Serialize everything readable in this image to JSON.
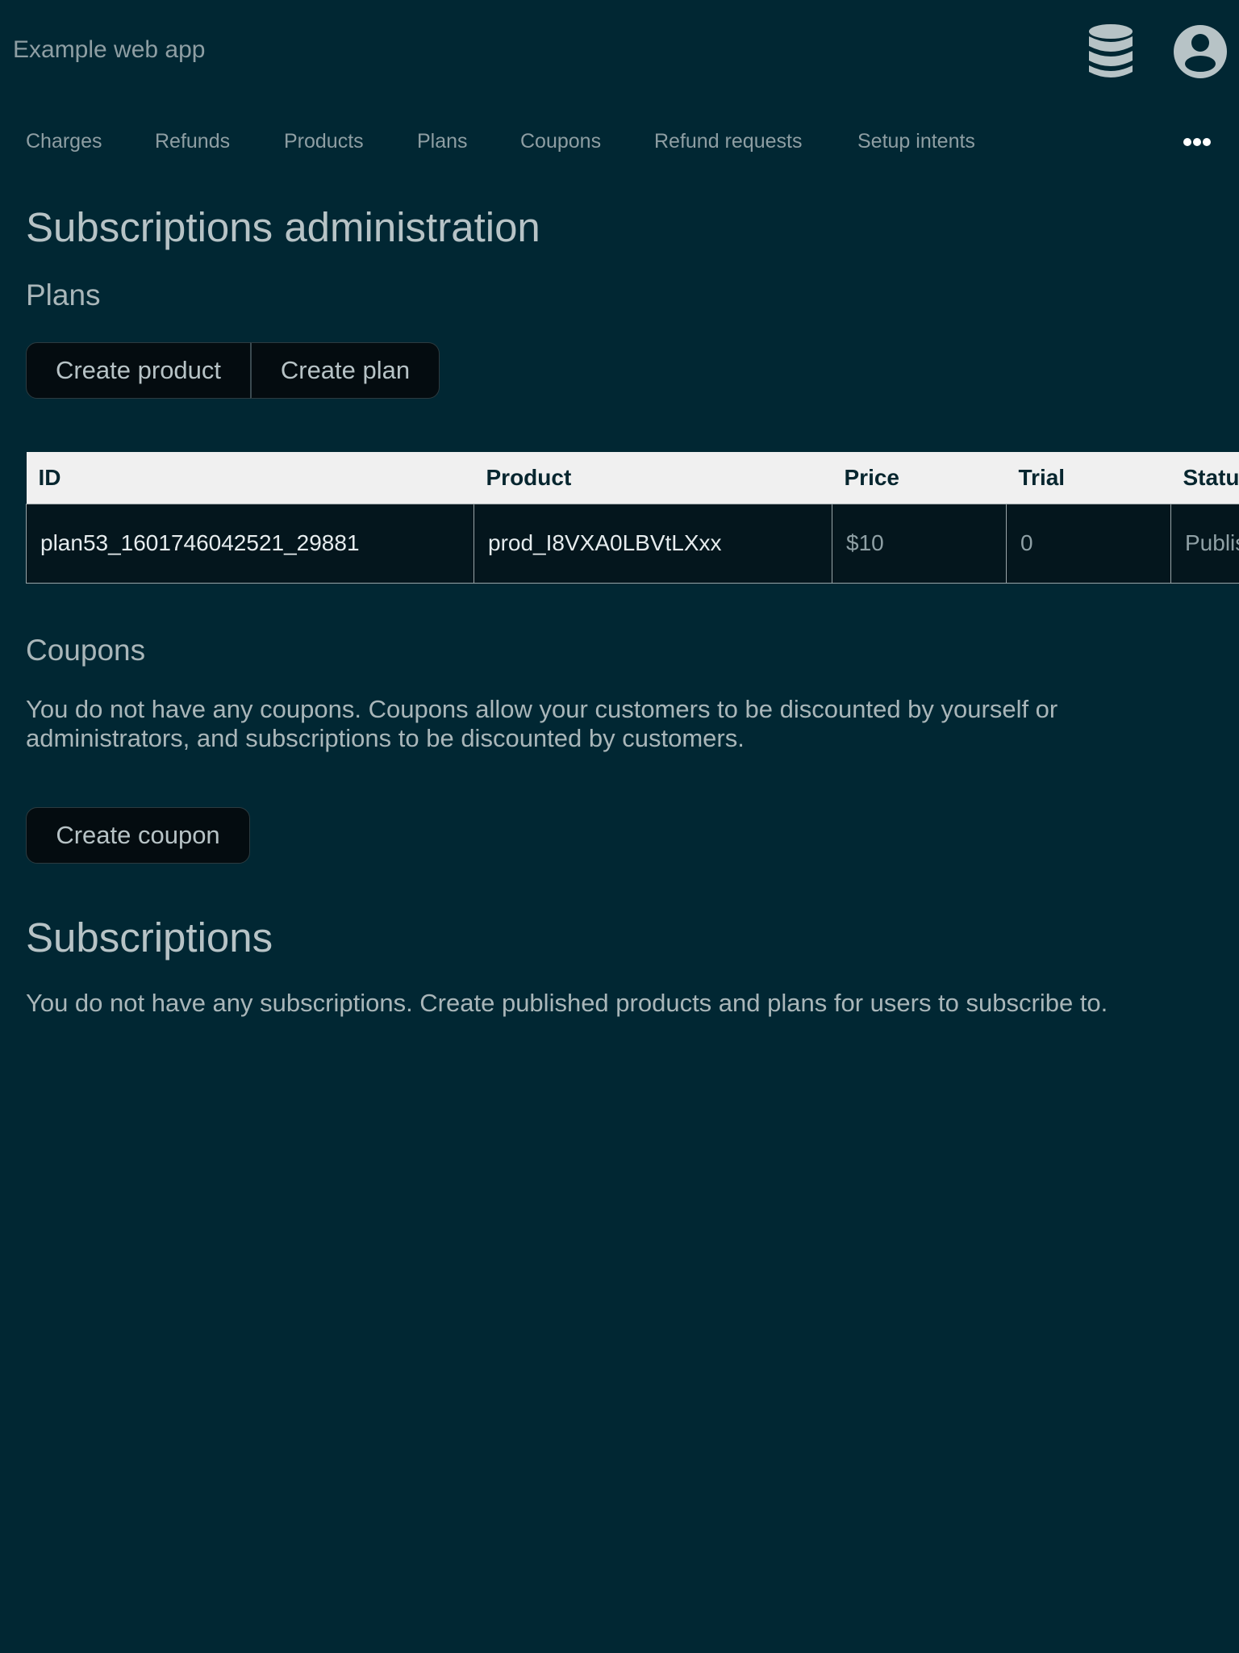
{
  "header": {
    "app_title": "Example web app",
    "database_icon": "database-icon",
    "account_icon": "user-account-icon"
  },
  "nav": {
    "items": [
      "Charges",
      "Refunds",
      "Products",
      "Plans",
      "Coupons",
      "Refund requests",
      "Setup intents"
    ],
    "more_icon": "more-horizontal-icon"
  },
  "main": {
    "title": "Subscriptions administration",
    "plans": {
      "heading": "Plans",
      "create_product_label": "Create product",
      "create_plan_label": "Create plan",
      "table": {
        "columns": [
          "ID",
          "Product",
          "Price",
          "Trial",
          "Status"
        ],
        "rows": [
          {
            "id": "plan53_1601746042521_29881",
            "product": "prod_I8VXA0LBVtLXxx",
            "price": "$10",
            "trial": "0",
            "status": "Published"
          }
        ]
      }
    },
    "coupons": {
      "heading": "Coupons",
      "empty_text": "You do not have any coupons. Coupons allow your customers to be discounted by yourself or administrators, and subscriptions to be discounted by customers.",
      "create_coupon_label": "Create coupon"
    },
    "subscriptions": {
      "heading": "Subscriptions",
      "empty_text": "You do not have any subscriptions. Create published products and plans for users to subscribe to."
    }
  },
  "colors": {
    "background": "#012733",
    "text": "#b7c3c6",
    "button_bg": "#040c10",
    "table_header_bg": "#f0f0f0"
  }
}
